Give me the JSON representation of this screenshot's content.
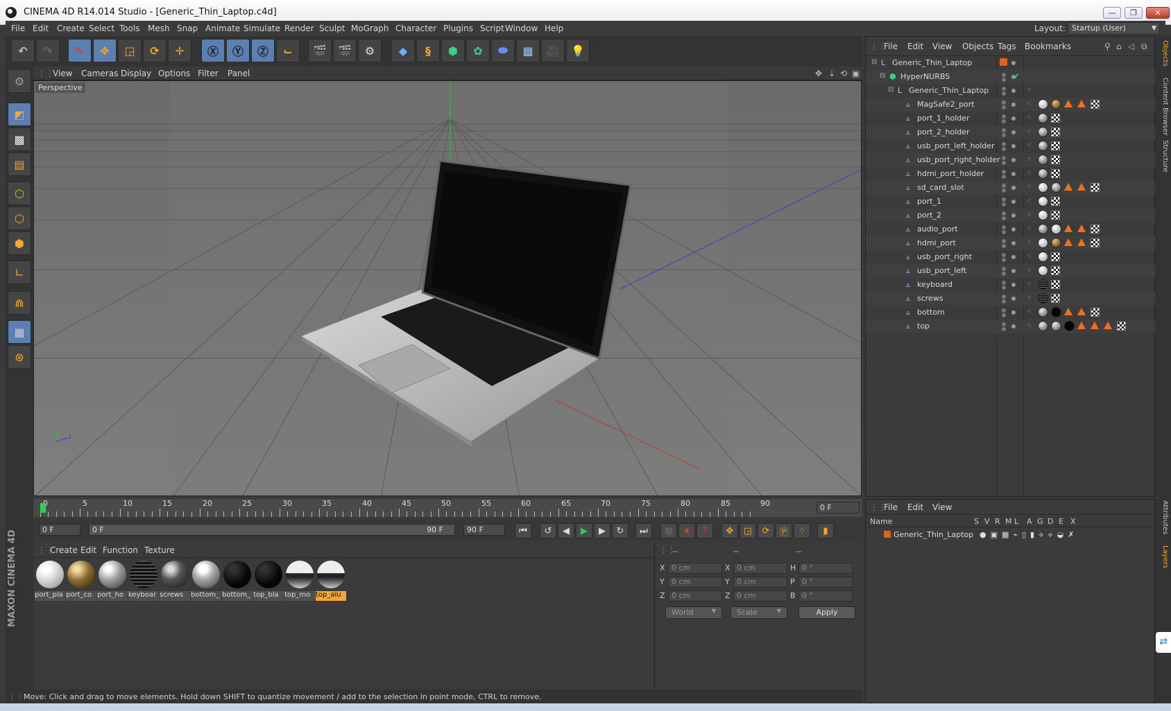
{
  "window": {
    "title": "CINEMA 4D R14.014 Studio - [Generic_Thin_Laptop.c4d]"
  },
  "menu": [
    "File",
    "Edit",
    "Create",
    "Select",
    "Tools",
    "Mesh",
    "Snap",
    "Animate",
    "Simulate",
    "Render",
    "Sculpt",
    "MoGraph",
    "Character",
    "Plugins",
    "Script",
    "Window",
    "Help"
  ],
  "layout": {
    "label": "Layout:",
    "value": "Startup (User)"
  },
  "viewport": {
    "menu": [
      "View",
      "Cameras",
      "Display",
      "Options",
      "Filter",
      "Panel"
    ],
    "camera_label": "Perspective"
  },
  "timeline": {
    "ticks": [
      "0",
      "5",
      "10",
      "15",
      "20",
      "25",
      "30",
      "35",
      "40",
      "45",
      "50",
      "55",
      "60",
      "65",
      "70",
      "75",
      "80",
      "85",
      "90"
    ],
    "current_frame": "0 F",
    "start": "0 F",
    "range_start": "0 F",
    "range_end": "90 F",
    "end": "90 F"
  },
  "materials": {
    "menu": [
      "Create",
      "Edit",
      "Function",
      "Texture"
    ],
    "items": [
      {
        "label": "port_pla",
        "style": "white"
      },
      {
        "label": "port_co",
        "style": "bronze"
      },
      {
        "label": "port_ho",
        "style": "grey"
      },
      {
        "label": "keyboar",
        "style": "dark-stripe"
      },
      {
        "label": "screws",
        "style": "dark-chrome"
      },
      {
        "label": "bottom_",
        "style": "chrome"
      },
      {
        "label": "bottom_",
        "style": "black"
      },
      {
        "label": "top_bla",
        "style": "black"
      },
      {
        "label": "top_mo",
        "style": "chrome-half"
      },
      {
        "label": "top_alu",
        "style": "chrome-half",
        "selected": true
      }
    ]
  },
  "coordinates": {
    "headers": [
      "--",
      "--",
      "--"
    ],
    "rows": [
      {
        "a": "X",
        "av": "0 cm",
        "b": "X",
        "bv": "0 cm",
        "c": "H",
        "cv": "0 °"
      },
      {
        "a": "Y",
        "av": "0 cm",
        "b": "Y",
        "bv": "0 cm",
        "c": "P",
        "cv": "0 °"
      },
      {
        "a": "Z",
        "av": "0 cm",
        "b": "Z",
        "bv": "0 cm",
        "c": "B",
        "cv": "0 °"
      }
    ],
    "mode1": "World",
    "mode2": "Scale",
    "apply": "Apply"
  },
  "status": "Move: Click and drag to move elements. Hold down SHIFT to quantize movement / add to the selection in point mode, CTRL to remove.",
  "objects": {
    "menu": [
      "File",
      "Edit",
      "View",
      "Objects",
      "Tags",
      "Bookmarks"
    ],
    "tree": [
      {
        "name": "Generic_Thin_Laptop",
        "depth": 0,
        "icon": "null-icon",
        "tags": []
      },
      {
        "name": "HyperNURBS",
        "depth": 1,
        "icon": "hypernurbs-icon",
        "tags": []
      },
      {
        "name": "Generic_Thin_Laptop",
        "depth": 2,
        "icon": "null-icon",
        "tags": []
      },
      {
        "name": "MagSafe2_port",
        "depth": 3,
        "icon": "polygon-icon",
        "tags": [
          "white",
          "bronze",
          "tri",
          "tri",
          "chk"
        ]
      },
      {
        "name": "port_1_holder",
        "depth": 3,
        "icon": "polygon-icon",
        "tags": [
          "grey",
          "chk"
        ]
      },
      {
        "name": "port_2_holder",
        "depth": 3,
        "icon": "polygon-icon",
        "tags": [
          "grey",
          "chk"
        ]
      },
      {
        "name": "usb_port_left_holder",
        "depth": 3,
        "icon": "polygon-icon",
        "tags": [
          "grey",
          "chk"
        ]
      },
      {
        "name": "usb_port_right_holder",
        "depth": 3,
        "icon": "polygon-icon",
        "tags": [
          "grey",
          "chk"
        ]
      },
      {
        "name": "hdmi_port_holder",
        "depth": 3,
        "icon": "polygon-icon",
        "tags": [
          "grey",
          "chk"
        ]
      },
      {
        "name": "sd_card_slot",
        "depth": 3,
        "icon": "polygon-icon",
        "tags": [
          "white",
          "grey",
          "tri",
          "tri",
          "chk"
        ]
      },
      {
        "name": "port_1",
        "depth": 3,
        "icon": "polygon-icon",
        "tags": [
          "white",
          "chk"
        ]
      },
      {
        "name": "port_2",
        "depth": 3,
        "icon": "polygon-icon",
        "tags": [
          "white",
          "chk"
        ]
      },
      {
        "name": "audio_port",
        "depth": 3,
        "icon": "polygon-icon",
        "tags": [
          "grey",
          "white",
          "tri",
          "tri",
          "chk"
        ]
      },
      {
        "name": "hdmi_port",
        "depth": 3,
        "icon": "polygon-icon",
        "tags": [
          "white",
          "bronze",
          "tri",
          "tri",
          "chk"
        ]
      },
      {
        "name": "usb_port_right",
        "depth": 3,
        "icon": "polygon-icon",
        "tags": [
          "white",
          "chk"
        ]
      },
      {
        "name": "usb_port_left",
        "depth": 3,
        "icon": "polygon-icon",
        "tags": [
          "white",
          "chk"
        ]
      },
      {
        "name": "keyboard",
        "depth": 3,
        "icon": "polygon-icon",
        "tags": [
          "dark",
          "chk"
        ]
      },
      {
        "name": "screws",
        "depth": 3,
        "icon": "polygon-icon",
        "tags": [
          "dark",
          "chk"
        ]
      },
      {
        "name": "bottom",
        "depth": 3,
        "icon": "polygon-icon",
        "tags": [
          "grey",
          "black",
          "tri",
          "tri",
          "chk"
        ]
      },
      {
        "name": "top",
        "depth": 3,
        "icon": "polygon-icon",
        "tags": [
          "grey",
          "grey",
          "black",
          "tri",
          "tri",
          "tri",
          "chk"
        ]
      }
    ]
  },
  "layers": {
    "menu": [
      "File",
      "Edit",
      "View"
    ],
    "columns": [
      "Name",
      "S",
      "V",
      "R",
      "M",
      "L",
      "A",
      "G",
      "D",
      "E",
      "X"
    ],
    "items": [
      {
        "name": "Generic_Thin_Laptop",
        "color": "#e06020"
      }
    ]
  },
  "sidetabs": [
    "Objects",
    "Content Browser",
    "Structure",
    "Attributes",
    "Layers"
  ],
  "app_brand": {
    "line1": "MAXON",
    "line2": "CINEMA 4D"
  },
  "colors": {
    "accent_selected": "#f0a830",
    "tag_orange": "#f07020",
    "axis_green": "#2fbf2f",
    "axis_blue": "#3b3bd6",
    "axis_red": "#c0392b"
  }
}
